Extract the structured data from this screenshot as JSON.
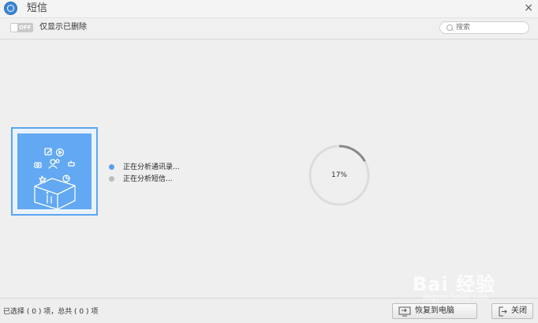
{
  "window": {
    "title": "短信",
    "close_glyph": "×",
    "app_icon": "app-logo-icon"
  },
  "toolbar": {
    "toggle_state": "OFF",
    "toggle_label": "仅显示已删除",
    "search_placeholder": "搜索"
  },
  "status": {
    "items": [
      {
        "text": "正在分析通讯录...",
        "dot_color": "#5b9ef0"
      },
      {
        "text": "正在分析短信...",
        "dot_color": "#bdbdbd"
      }
    ]
  },
  "progress": {
    "percent": 17,
    "label": "17%"
  },
  "footer": {
    "selection_text": "已选择 ( 0 ) 项，总共 ( 0 ) 项",
    "restore_button": "恢复到电脑",
    "close_button": "关闭"
  },
  "watermark": {
    "text": "Bai 经验",
    "sub": "jingyan.baidu.com"
  },
  "colors": {
    "accent": "#5b9ef0",
    "illustration_bg": "#62a8f2",
    "progress_ring": "#8a8a8a",
    "progress_track": "#dcdcdc"
  }
}
